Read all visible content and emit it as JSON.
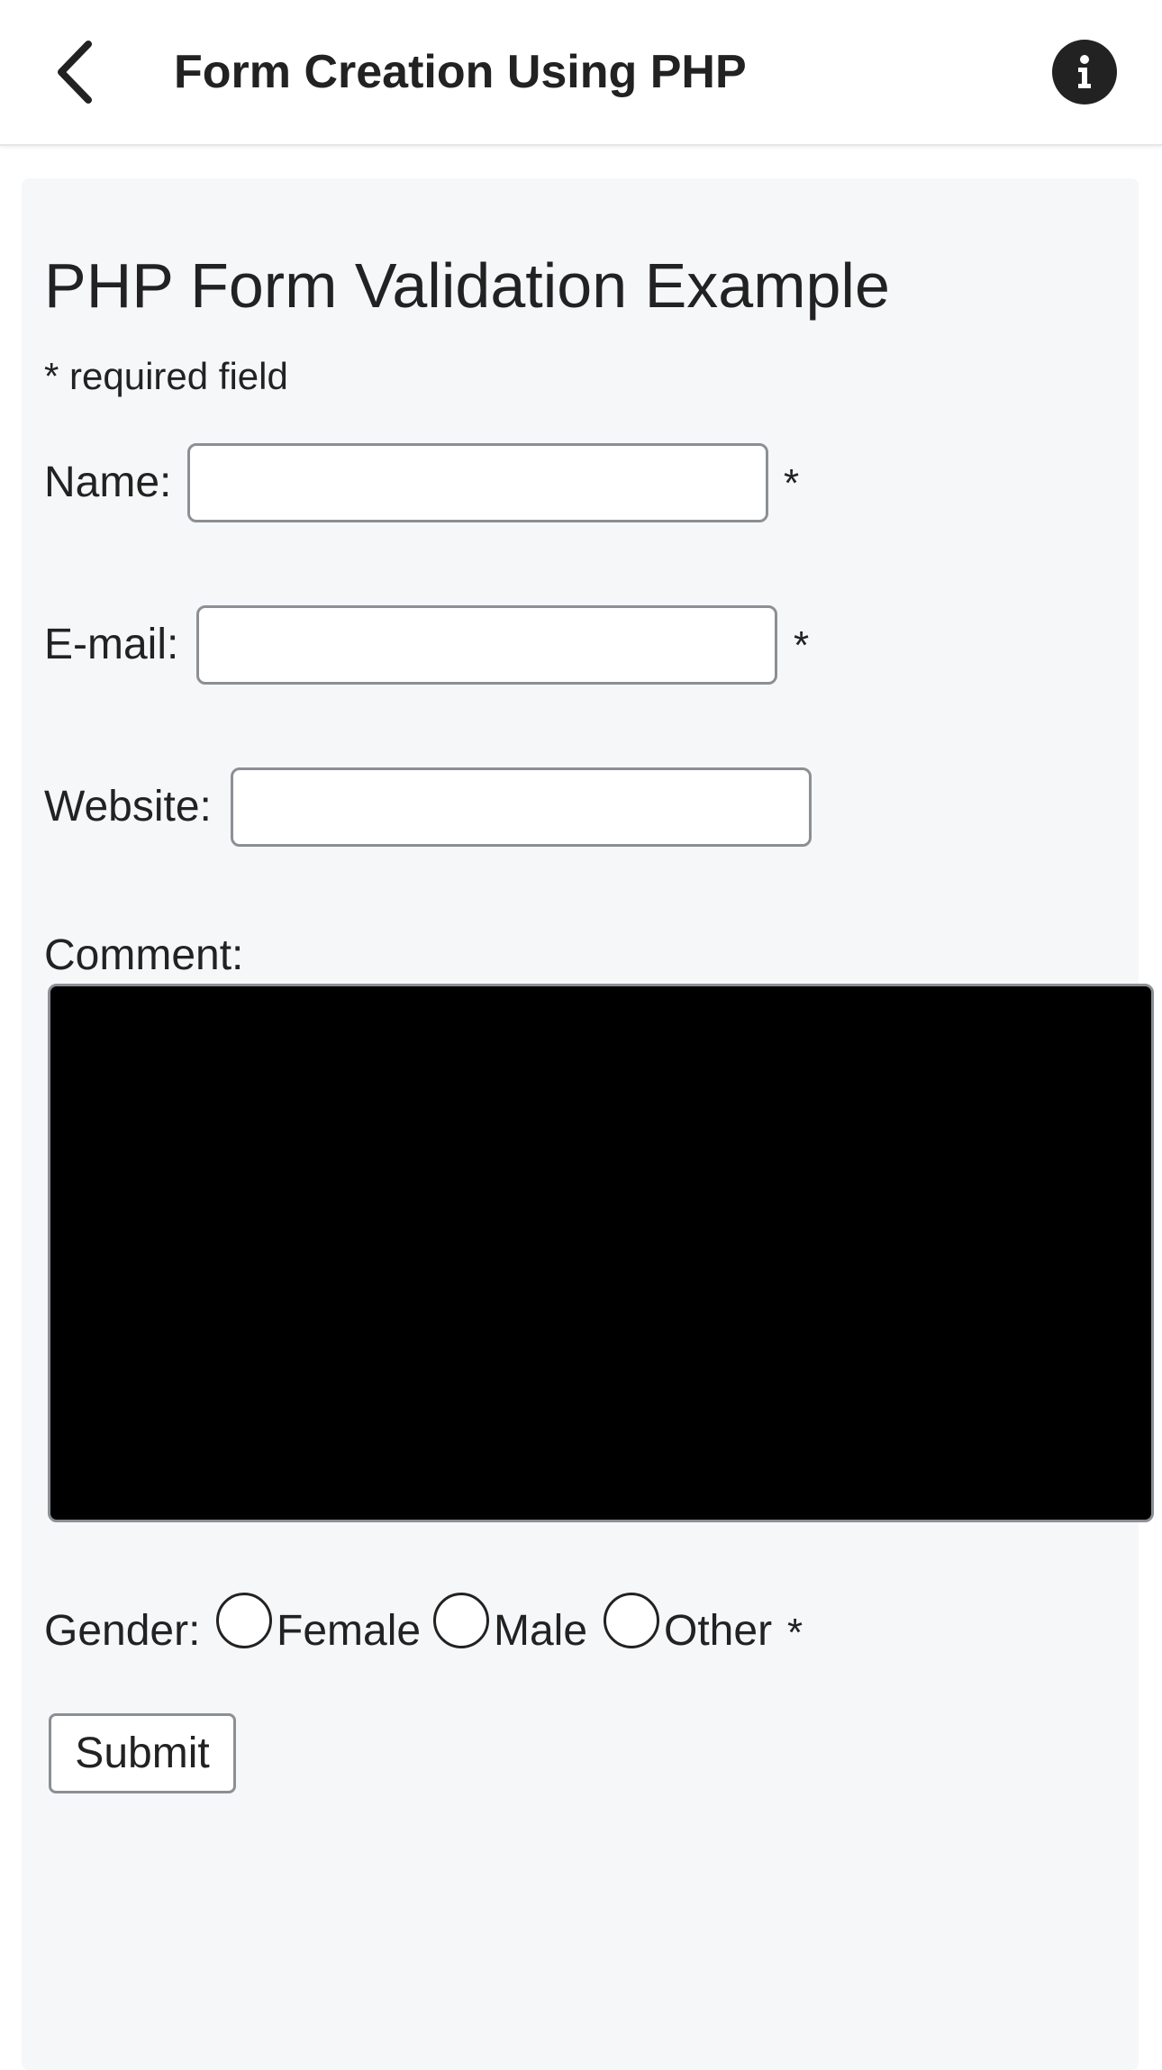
{
  "app_bar": {
    "title": "Form Creation Using PHP",
    "back_icon": "chevron-left-icon",
    "info_icon": "info-icon"
  },
  "form": {
    "heading": "PHP Form Validation Example",
    "required_note": "* required field",
    "name": {
      "label": "Name:",
      "value": "",
      "required_marker": "*"
    },
    "email": {
      "label": "E-mail:",
      "value": "",
      "required_marker": "*"
    },
    "website": {
      "label": "Website:",
      "value": ""
    },
    "comment": {
      "label": "Comment:",
      "value": ""
    },
    "gender": {
      "label": "Gender:",
      "options": [
        "Female",
        "Male",
        "Other"
      ],
      "selected": null,
      "required_marker": "*"
    },
    "submit_label": "Submit"
  },
  "colors": {
    "panel_background": "#f6f7f9",
    "text": "#222222",
    "input_border": "#8c8f94",
    "comment_background": "#000000"
  }
}
